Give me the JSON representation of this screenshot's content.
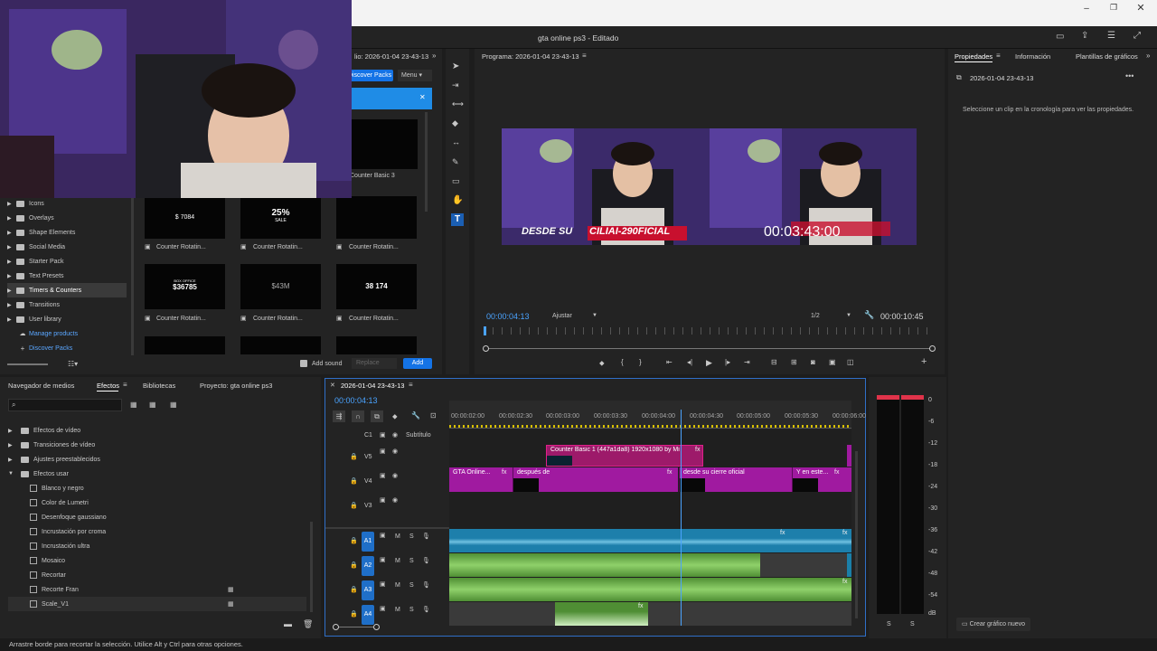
{
  "window": {
    "title": "gta online ps3 - Editado",
    "controls": [
      "minimize",
      "maximize",
      "close"
    ]
  },
  "essential_graphics": {
    "panel_title_fragment": "lio: 2026-01-04 23-43-13",
    "discover_packs_label": "Discover Packs",
    "menu_label": "Menu",
    "categories": [
      "Icons",
      "Overlays",
      "Shape Elements",
      "Social Media",
      "Starter Pack",
      "Text Presets",
      "Timers & Counters",
      "Transitions",
      "User library"
    ],
    "selected_category": "Timers & Counters",
    "manage_products": "Manage products",
    "discover_packs_link": "Discover Packs",
    "thumb_top_label": "Counter Basic 3",
    "thumbs": [
      {
        "label": "Counter Rotatin...",
        "preview": "$ 7084"
      },
      {
        "label": "Counter Rotatin...",
        "preview": "25%",
        "sub": "SALE"
      },
      {
        "label": "Counter Rotatin...",
        "preview": ""
      },
      {
        "label": "Counter Rotatin...",
        "preview": "$36785",
        "sub": "BOX OFFICE"
      },
      {
        "label": "Counter Rotatin...",
        "preview": "$43M"
      },
      {
        "label": "Counter Rotatin...",
        "preview": "38 174"
      }
    ],
    "add_sound_label": "Add sound",
    "replace_label": "Replace",
    "add_label": "Add"
  },
  "program_monitor": {
    "title": "Programa: 2026-01-04 23-43-13",
    "timecode": "00:00:04:13",
    "fit_label": "Ajustar",
    "resolution": "1/2",
    "duration": "00:00:10:45",
    "overlay_left_a": "DESDE SU ",
    "overlay_left_b": "CILIAI-290FICIAL",
    "overlay_right": "00:03:43:00"
  },
  "properties": {
    "tabs": [
      "Propiedades",
      "Información",
      "Plantillas de gráficos"
    ],
    "clip_name": "2026-01-04 23-43-13",
    "message": "Seleccione un clip en la cronología para ver las propiedades.",
    "new_graphic_label": "Crear gráfico nuevo"
  },
  "effects_panel": {
    "tabs": [
      "Navegador de medios",
      "Efectos",
      "Bibliotecas",
      "Proyecto: gta online ps3"
    ],
    "active_tab": "Efectos",
    "folders": [
      "Efectos de vídeo",
      "Transiciones de vídeo",
      "Ajustes preestablecidos",
      "Efectos usar"
    ],
    "effects": [
      "Blanco y negro",
      "Color de Lumetri",
      "Desenfoque gaussiano",
      "Incrustación por croma",
      "Incrustación ultra",
      "Mosaico",
      "Recortar",
      "Recorte Fran",
      "Scale_V1"
    ]
  },
  "timeline": {
    "sequence_name": "2026-01-04 23-43-13",
    "timecode": "00:00:04:13",
    "ruler_labels": [
      "00:00:02:00",
      "00:00:02:30",
      "00:00:03:00",
      "00:00:03:30",
      "00:00:04:00",
      "00:00:04:30",
      "00:00:05:00",
      "00:00:05:30",
      "00:00:06:00"
    ],
    "caption_track": {
      "name": "C1",
      "label": "Subtítulo"
    },
    "video_tracks": [
      "V5",
      "V4",
      "V3"
    ],
    "audio_tracks": [
      "A1",
      "A2",
      "A3",
      "A4"
    ],
    "clips": {
      "v5_counter": "Counter Basic 1 (447a1da8) 1920x1080 by Mist...",
      "v4_a": "GTA Online...",
      "v4_b": "después de",
      "v4_c": "desde su cierre oficial",
      "v4_d": "Y en este..."
    },
    "playhead_fraction": 0.575
  },
  "audio_meter": {
    "scale": [
      "0",
      "-6",
      "-12",
      "-18",
      "-24",
      "-30",
      "-36",
      "-42",
      "-48",
      "-54",
      "dB"
    ],
    "solo": [
      "S",
      "S"
    ]
  },
  "status_bar": "Arrastre borde para recortar la selección. Utilice Alt y Ctrl para otras opciones."
}
